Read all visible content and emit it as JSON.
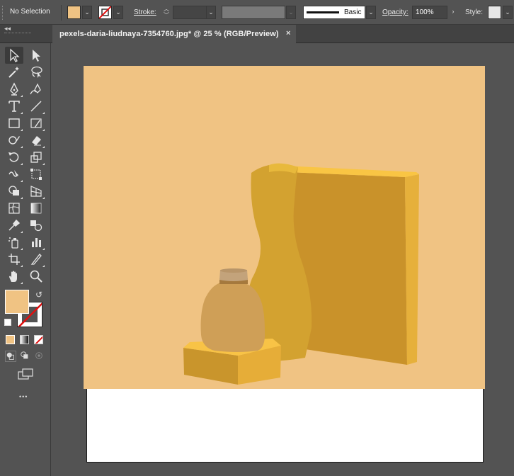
{
  "control_bar": {
    "selection_label": "No Selection",
    "fill_color": "#f0c383",
    "stroke_label": "Stroke:",
    "stroke_weight": "",
    "brush_name": "Basic",
    "opacity_label": "Opacity:",
    "opacity_value": "100%",
    "style_label": "Style:"
  },
  "document": {
    "tab_title": "pexels-daria-liudnaya-7354760.jpg* @ 25 % (RGB/Preview)",
    "close_glyph": "×",
    "collapse_glyph": "◂◂"
  },
  "toolbar": {
    "more_tools_glyph": "•••",
    "fill_color": "#f0c383",
    "stroke_color": "#ffffff",
    "tools": [
      "selection-tool",
      "direct-selection-tool",
      "magic-wand-tool",
      "lasso-tool",
      "pen-tool",
      "curvature-tool",
      "type-tool",
      "line-segment-tool",
      "rectangle-tool",
      "paintbrush-tool",
      "shaper-tool",
      "eraser-tool",
      "rotate-tool",
      "scale-tool",
      "warp-tool",
      "free-transform-tool",
      "shape-builder-tool",
      "perspective-grid-tool",
      "mesh-tool",
      "gradient-tool",
      "eyedropper-tool",
      "blend-tool",
      "symbol-sprayer-tool",
      "column-graph-tool",
      "artboard-tool",
      "slice-tool",
      "hand-tool",
      "zoom-tool"
    ]
  },
  "artwork": {
    "background": "#f0c383",
    "box_front": "#c9922a",
    "box_side": "#e6b03b",
    "box_top": "#f9c544",
    "tall_bottle": "#d3a230",
    "small_bottle": "#cf9f57",
    "cork": "#c3a37b",
    "base_block_front": "#c9952c",
    "base_block_side": "#e6ad38",
    "base_block_top": "#f8c346"
  }
}
